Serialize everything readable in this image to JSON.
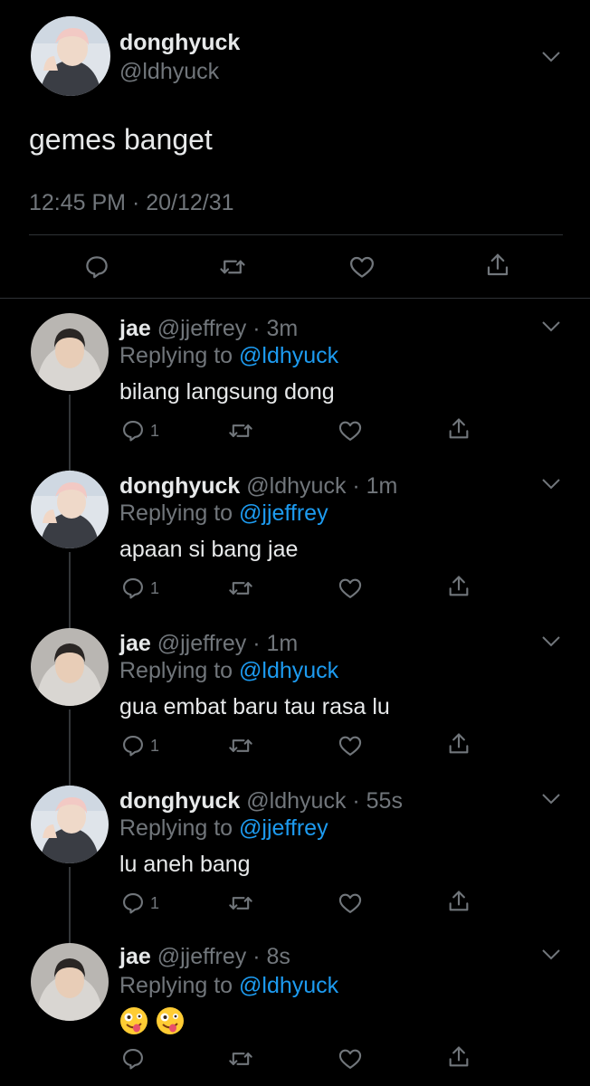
{
  "main_tweet": {
    "name": "donghyuck",
    "handle": "@ldhyuck",
    "text": "gemes banget",
    "timestamp": "12:45 PM · 20/12/31",
    "actions": [
      "reply-icon",
      "retweet-icon",
      "like-icon",
      "share-icon"
    ]
  },
  "replies": [
    {
      "name": "jae",
      "meta": "@jjeffrey · 3m",
      "replying_prefix": "Replying to ",
      "replying_to": "@ldhyuck",
      "text": "bilang langsung dong",
      "reply_count": "1"
    },
    {
      "name": "donghyuck",
      "meta": "@ldhyuck · 1m",
      "replying_prefix": "Replying to ",
      "replying_to": "@jjeffrey",
      "text": "apaan si bang jae",
      "reply_count": "1"
    },
    {
      "name": "jae",
      "meta": "@jjeffrey · 1m",
      "replying_prefix": "Replying to ",
      "replying_to": "@ldhyuck",
      "text": "gua embat baru tau rasa lu",
      "reply_count": "1"
    },
    {
      "name": "donghyuck",
      "meta": "@ldhyuck · 55s",
      "replying_prefix": "Replying to ",
      "replying_to": "@jjeffrey",
      "text": "lu aneh bang",
      "reply_count": "1"
    },
    {
      "name": "jae",
      "meta": "@jjeffrey · 8s",
      "replying_prefix": "Replying to ",
      "replying_to": "@ldhyuck",
      "text": "",
      "emojis": [
        "zany-face-emoji",
        "zany-face-emoji"
      ],
      "reply_count": ""
    }
  ],
  "colors": {
    "background": "#000000",
    "primary_text": "#e7e9ea",
    "secondary_text": "#71767b",
    "link": "#1d9bf0",
    "divider": "#2f3336"
  }
}
